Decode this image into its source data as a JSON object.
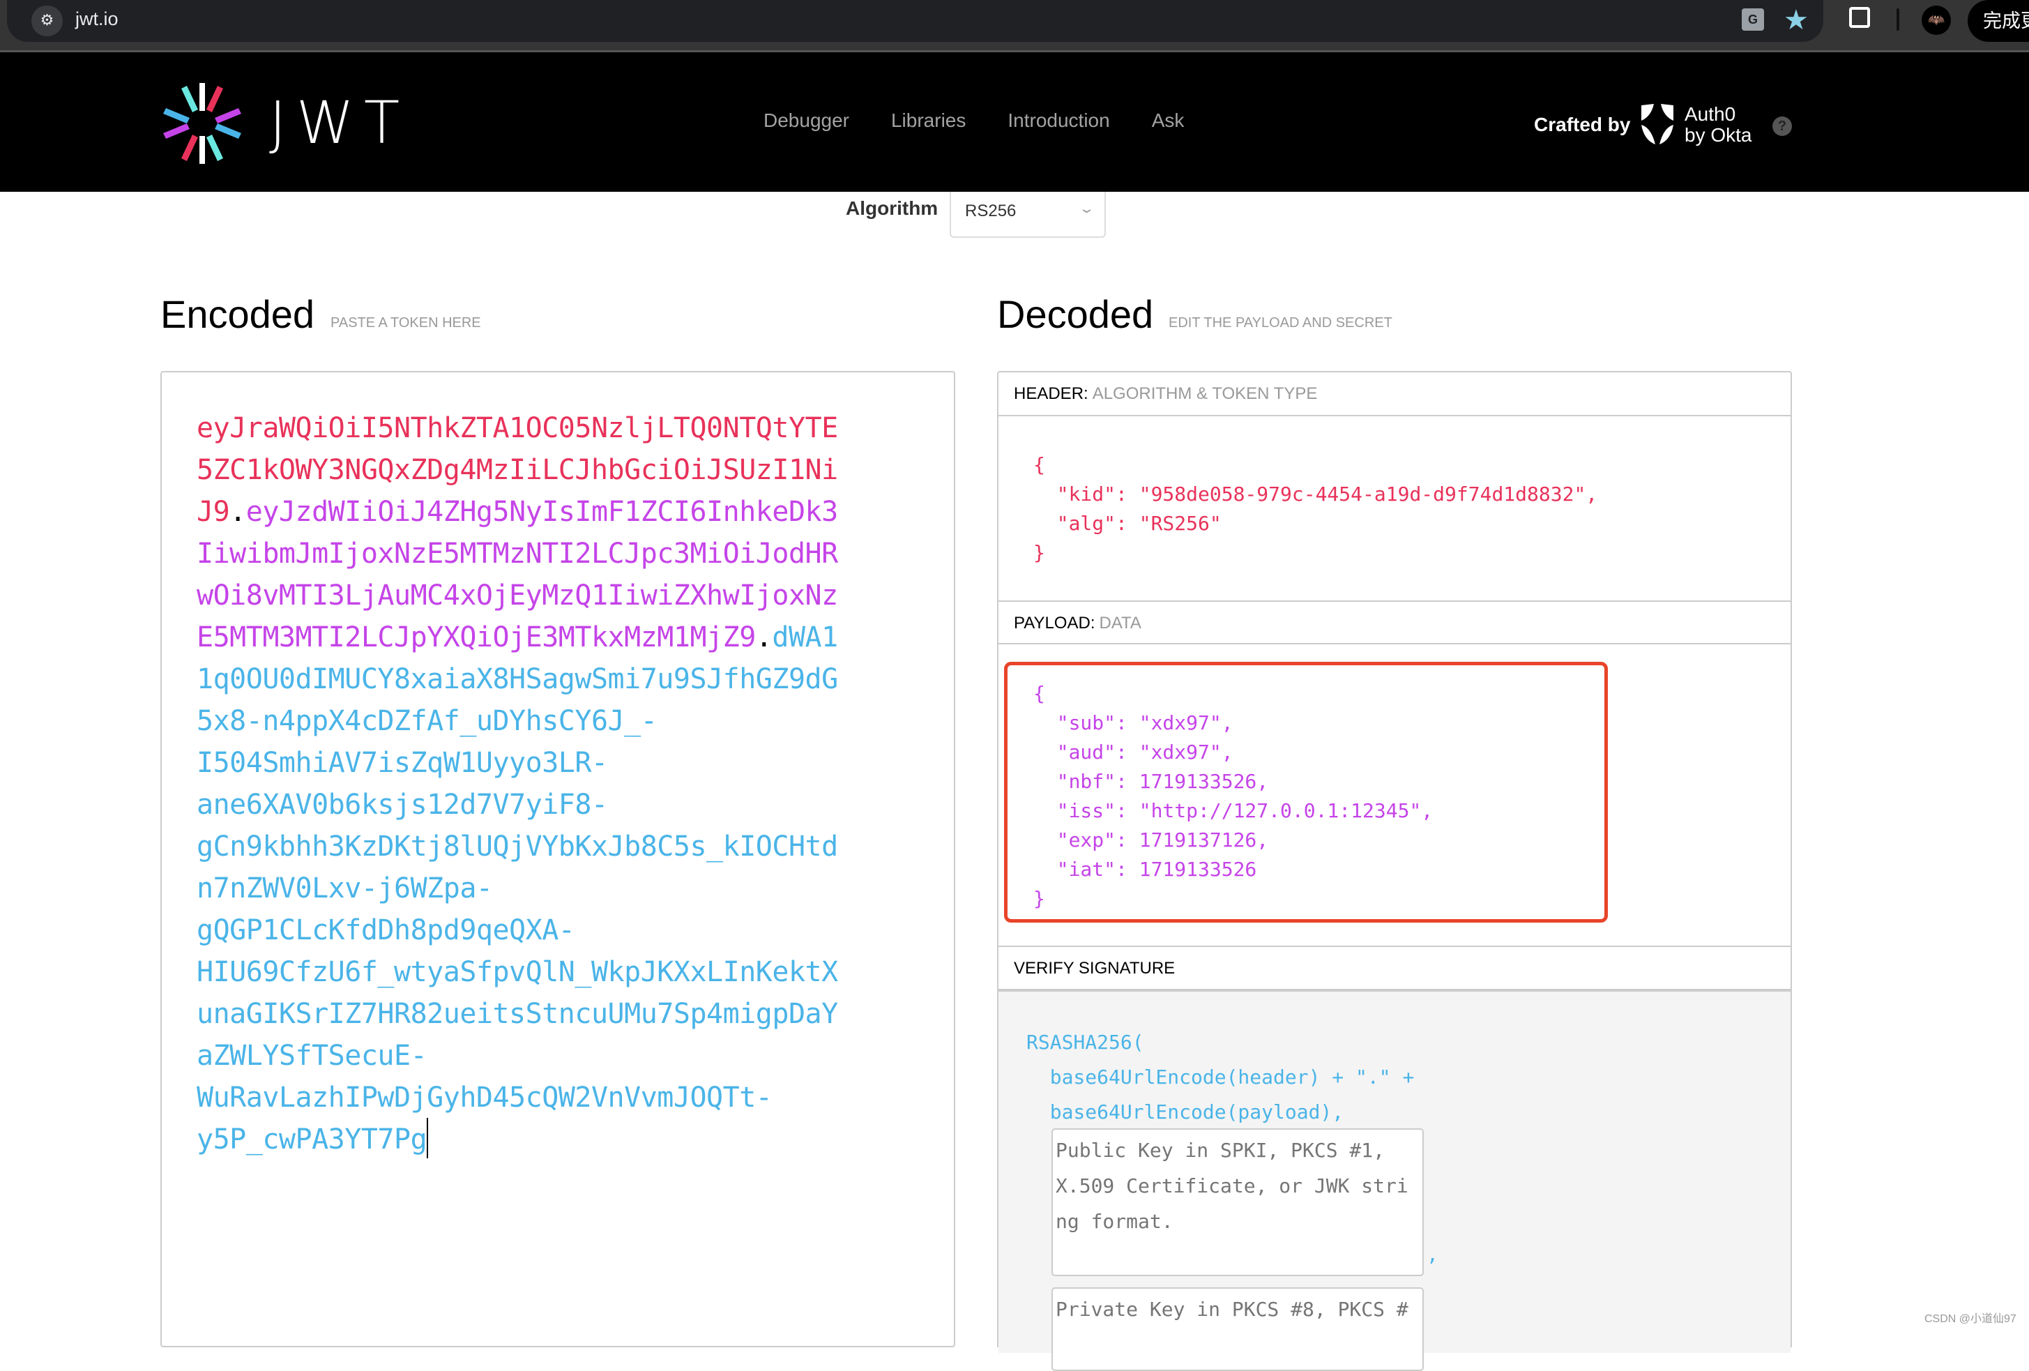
{
  "browser": {
    "url": "jwt.io",
    "site_info_icon": "tune-icon",
    "update_button_label": "完成更"
  },
  "header": {
    "logo_text": "JWT",
    "nav": [
      "Debugger",
      "Libraries",
      "Introduction",
      "Ask"
    ],
    "crafted_by": "Crafted by",
    "auth0_line1": "Auth0",
    "auth0_line2": "by Okta",
    "help_label": "?"
  },
  "algorithm": {
    "label": "Algorithm",
    "selected": "RS256"
  },
  "encoded": {
    "title": "Encoded",
    "subtitle": "PASTE A TOKEN HERE",
    "token_header": "eyJraWQiOiI5NThkZTA1OC05NzljLTQ0NTQtYTE5ZC1kOWY3NGQxZDg4MzIiLCJhbGciOiJSUzI1NiJ9",
    "token_payload": "eyJzdWIiOiJ4ZHg5NyIsImF1ZCI6InhkeDk3IiwibmJmIjoxNzE5MTMzNTI2LCJpc3MiOiJodHRwOi8vMTI3LjAuMC4xOjEyMzQ1IiwiZXhwIjoxNzE5MTM3MTI2LCJpYXQiOjE3MTkxMzM1MjZ9",
    "token_signature": "dWA11q0OU0dIMUCY8xaiaX8HSagwSmi7u9SJfhGZ9dG5x8-n4ppX4cDZfAf_uDYhsCY6J_-I504SmhiAV7isZqW1Uyyo3LR-ane6XAV0b6ksjs12d7V7yiF8-gCn9kbhh3KzDKtj8lUQjVYbKxJb8C5s_kIOCHtdn7nZWV0Lxv-j6WZpa-gQGP1CLcKfdDh8pd9qeQXA-HIU69CfzU6f_wtyaSfpvQlN_WkpJKXxLInKektXunaGIKSrIZ7HR82ueitsStncuUMu7Sp4migpDaYaZWLYSfTSecuE-WuRavLazhIPwDjGyhD45cQW2VnVvmJOQTt-y5P_cwPA3YT7Pg",
    "token_lines": [
      {
        "parts": [
          {
            "t": "eyJraWQiOiI5NThkZTA1OC05NzljLTQ0NTQtYTE",
            "c": "header"
          }
        ]
      },
      {
        "parts": [
          {
            "t": "5ZC1kOWY3NGQxZDg4MzIiLCJhbGciOiJSUzI1Ni",
            "c": "header"
          }
        ]
      },
      {
        "parts": [
          {
            "t": "J9",
            "c": "header"
          },
          {
            "t": ".",
            "c": "dot"
          },
          {
            "t": "eyJzdWIiOiJ4ZHg5NyIsImF1ZCI6InhkeDk3",
            "c": "payload"
          }
        ]
      },
      {
        "parts": [
          {
            "t": "IiwibmJmIjoxNzE5MTMzNTI2LCJpc3MiOiJodHR",
            "c": "payload"
          }
        ]
      },
      {
        "parts": [
          {
            "t": "wOi8vMTI3LjAuMC4xOjEyMzQ1IiwiZXhwIjoxNz",
            "c": "payload"
          }
        ]
      },
      {
        "parts": [
          {
            "t": "E5MTM3MTI2LCJpYXQiOjE3MTkxMzM1MjZ9",
            "c": "payload"
          },
          {
            "t": ".",
            "c": "dot"
          },
          {
            "t": "dWA1",
            "c": "sig"
          }
        ]
      },
      {
        "parts": [
          {
            "t": "1q0OU0dIMUCY8xaiaX8HSagwSmi7u9SJfhGZ9dG",
            "c": "sig"
          }
        ]
      },
      {
        "parts": [
          {
            "t": "5x8-n4ppX4cDZfAf_uDYhsCY6J_-",
            "c": "sig"
          }
        ]
      },
      {
        "parts": [
          {
            "t": "I504SmhiAV7isZqW1Uyyo3LR-",
            "c": "sig"
          }
        ]
      },
      {
        "parts": [
          {
            "t": "ane6XAV0b6ksjs12d7V7yiF8-",
            "c": "sig"
          }
        ]
      },
      {
        "parts": [
          {
            "t": "gCn9kbhh3KzDKtj8lUQjVYbKxJb8C5s_kIOCHtd",
            "c": "sig"
          }
        ]
      },
      {
        "parts": [
          {
            "t": "n7nZWV0Lxv-j6WZpa-",
            "c": "sig"
          }
        ]
      },
      {
        "parts": [
          {
            "t": "gQGP1CLcKfdDh8pd9qeQXA-",
            "c": "sig"
          }
        ]
      },
      {
        "parts": [
          {
            "t": "HIU69CfzU6f_wtyaSfpvQlN_WkpJKXxLInKektX",
            "c": "sig"
          }
        ]
      },
      {
        "parts": [
          {
            "t": "unaGIKSrIZ7HR82ueitsStncuUMu7Sp4migpDaY",
            "c": "sig"
          }
        ]
      },
      {
        "parts": [
          {
            "t": "aZWLYSfTSecuE-",
            "c": "sig"
          }
        ]
      },
      {
        "parts": [
          {
            "t": "WuRavLazhIPwDjGyhD45cQW2VnVvmJOQTt-",
            "c": "sig"
          }
        ]
      },
      {
        "parts": [
          {
            "t": "y5P_cwPA3YT7Pg",
            "c": "sig"
          }
        ]
      }
    ]
  },
  "decoded": {
    "title": "Decoded",
    "subtitle": "EDIT THE PAYLOAD AND SECRET",
    "header_section": {
      "label": "HEADER:",
      "sublabel": "ALGORITHM & TOKEN TYPE",
      "json_lines": [
        "{",
        "  \"kid\": \"958de058-979c-4454-a19d-d9f74d1d8832\",",
        "  \"alg\": \"RS256\"",
        "}"
      ]
    },
    "payload_section": {
      "label": "PAYLOAD:",
      "sublabel": "DATA",
      "json_lines": [
        "{",
        "  \"sub\": \"xdx97\",",
        "  \"aud\": \"xdx97\",",
        "  \"nbf\": 1719133526,",
        "  \"iss\": \"http://127.0.0.1:12345\",",
        "  \"exp\": 1719137126,",
        "  \"iat\": 1719133526",
        "}"
      ]
    },
    "verify_section": {
      "label": "VERIFY SIGNATURE",
      "code_lines": [
        "RSASHA256(",
        "  base64UrlEncode(header) + \".\" +",
        "  base64UrlEncode(payload),"
      ],
      "public_key_placeholder": "Public Key in SPKI, PKCS #1, X.509 Certificate, or JWK string format.",
      "private_key_placeholder": "Private Key in PKCS #8, PKCS #",
      "comma": ","
    }
  },
  "colors": {
    "header_token": "#e8325a",
    "payload_token": "#c544e8",
    "signature_token": "#4ab4e8",
    "highlight_border": "#e8442a"
  },
  "watermark": "CSDN @小道仙97"
}
